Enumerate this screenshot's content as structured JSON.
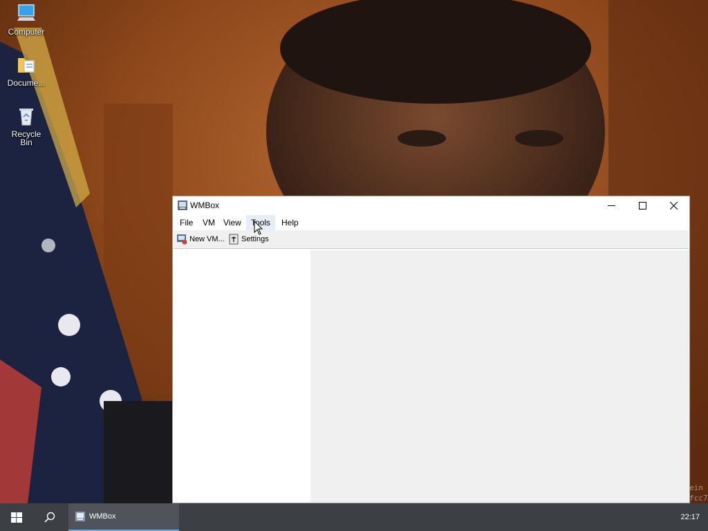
{
  "desktop": {
    "icons": [
      {
        "label": "Computer",
        "icon": "computer-icon"
      },
      {
        "label": "Docume...",
        "icon": "documents-icon"
      },
      {
        "label": "Recycle\nBin",
        "icon": "recycle-bin-icon"
      }
    ]
  },
  "window": {
    "title": "WMBox",
    "controls": {
      "minimize": "minimize-icon",
      "maximize": "maximize-icon",
      "close": "close-icon"
    },
    "menu": [
      "File",
      "VM",
      "View",
      "Tools",
      "Help"
    ],
    "menu_hover": "Tools",
    "toolbar": [
      {
        "label": "New VM...",
        "icon": "new-vm-icon"
      },
      {
        "label": "Settings",
        "icon": "settings-icon"
      }
    ]
  },
  "taskbar": {
    "start_icon": "windows-logo-icon",
    "search_icon": "search-icon",
    "tasks": [
      {
        "label": "WMBox",
        "icon": "wmbox-app-icon",
        "active": true
      }
    ],
    "clock": "22:17"
  },
  "watermark": [
    "ein",
    "fcc7"
  ],
  "colors": {
    "taskbar": "#3c3f44",
    "active_task_underline": "#6aa8e8",
    "menu_hover": "#e5eef8",
    "pane_gray": "#f0f0f0"
  }
}
